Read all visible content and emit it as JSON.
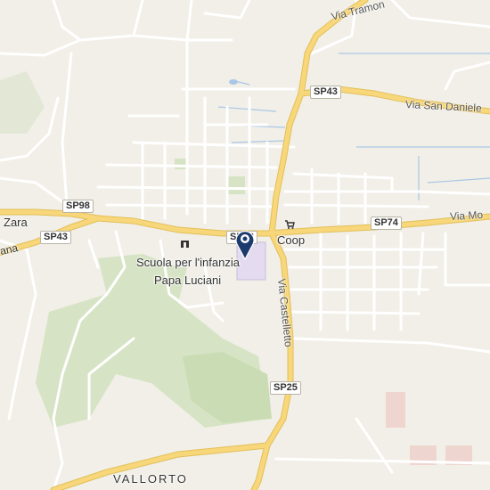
{
  "road_shields": {
    "sp43_north": "SP43",
    "sp98": "SP98",
    "sp43_west": "SP43",
    "sp74": "SP74",
    "sp25": "SP25",
    "sp_center": "SP43"
  },
  "street_names": {
    "via_tramonti": "Via Tramon",
    "via_san_daniele": "Via San Daniele",
    "via_mo": "Via Mo",
    "via_castelletto": "Via Castelletto"
  },
  "places": {
    "zara": "Zara",
    "ana": "ana",
    "coop": "Coop",
    "school_line1": "Scuola per l'infanzia",
    "school_line2": "Papa Luciani",
    "vallorto": "VALLORTO"
  },
  "icons": {
    "pin": "location-pin-icon",
    "shop": "shopping-cart-icon",
    "school": "school-icon"
  },
  "colors": {
    "background": "#f1efe7",
    "major_road": "#f7d77a",
    "minor_road": "#ffffff",
    "park": "#d6e3c4",
    "water": "#a9c7e6",
    "pin": "#1c3a6e"
  }
}
